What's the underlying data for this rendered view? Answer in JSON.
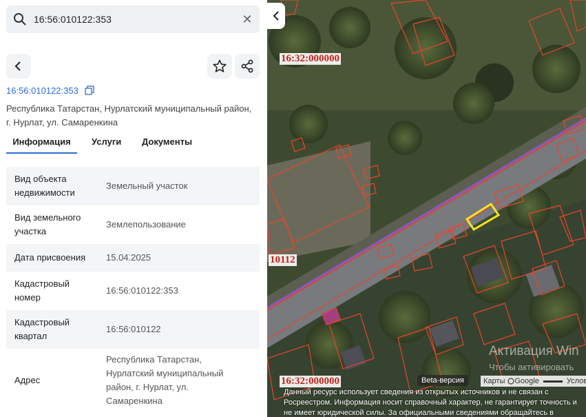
{
  "search": {
    "value": "16:56:010122:353"
  },
  "card": {
    "cadastral_number": "16:56:010122:353",
    "address_text": "Республика Татарстан, Нурлатский муниципальный район, г. Нурлат, ул. Самаренкина"
  },
  "tabs": [
    {
      "label": "Информация",
      "active": true
    },
    {
      "label": "Услуги",
      "active": false
    },
    {
      "label": "Документы",
      "active": false
    }
  ],
  "info_rows": [
    {
      "label": "Вид объекта недвижимости",
      "value": "Земельный участок"
    },
    {
      "label": "Вид земельного участка",
      "value": "Землепользование"
    },
    {
      "label": "Дата присвоения",
      "value": "15.04.2025"
    },
    {
      "label": "Кадастровый номер",
      "value": "16:56:010122:353"
    },
    {
      "label": "Кадастровый квартал",
      "value": "16:56:010122"
    },
    {
      "label": "Адрес",
      "value": "Республика Татарстан, Нурлатский муниципальный район, г. Нурлат, ул. Самаренкина"
    }
  ],
  "map": {
    "labels": [
      "16:32:000000",
      "10112",
      "16:32:000000"
    ],
    "beta_label": "Beta-версия",
    "maps_label": "Карты",
    "google_label": "Google",
    "conditions_label": "Условия",
    "activation_title": "Активация Win",
    "activation_sub": "Чтобы активировать",
    "disclaimer": "Данный ресурс использует сведения из открытых источников и не связан с Росреестром. Информация носит справочный характер, не гарантирует точность и не имеет юридической силы. За официальными сведениями обращайтесь в Росреестр."
  },
  "colors": {
    "accent": "#2b6cd3",
    "parcel": "#e8452d",
    "highlight": "#f4e51f"
  }
}
